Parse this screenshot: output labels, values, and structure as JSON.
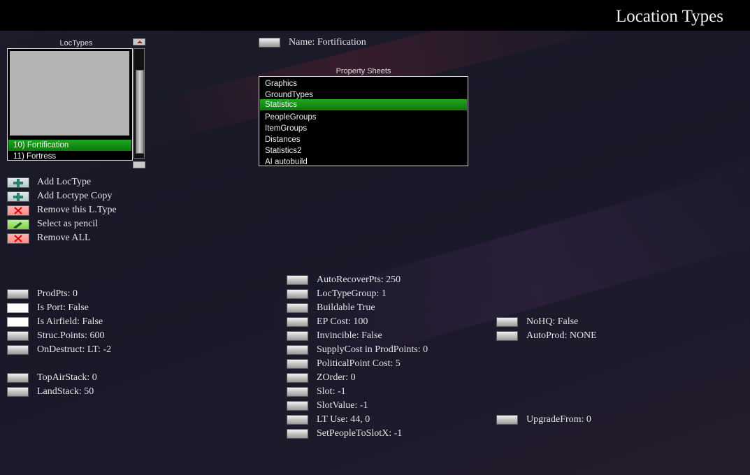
{
  "window": {
    "title": "Location Types"
  },
  "loctypes": {
    "title": "LocTypes",
    "items": [
      "10) Fortification",
      "11) Fortress"
    ],
    "selected_index": 0
  },
  "name_label": "Name: Fortification",
  "property_sheets": {
    "title": "Property Sheets",
    "items": [
      "Graphics",
      "GroundTypes",
      "Statistics",
      "PeopleGroups",
      "ItemGroups",
      "Distances",
      "Statistics2",
      "AI autobuild"
    ],
    "selected_index": 2
  },
  "actions": [
    {
      "label": "Add LocType",
      "icon": "plus-icon"
    },
    {
      "label": "Add Loctype Copy",
      "icon": "plus-icon"
    },
    {
      "label": "Remove this L.Type",
      "icon": "x-icon"
    },
    {
      "label": "Select as pencil",
      "icon": "pencil-icon"
    },
    {
      "label": "Remove ALL",
      "icon": "x-icon"
    }
  ],
  "left_props": [
    "ProdPts:  0",
    "Is Port: False",
    "Is Airfield: False",
    "Struc.Points:  600",
    "OnDestruct: LT: -2",
    "TopAirStack:  0",
    "LandStack:  50"
  ],
  "middle_props": [
    "AutoRecoverPts:  250",
    "LocTypeGroup:  1",
    "Buildable True",
    "EP Cost:  100",
    "Invincible: False",
    "SupplyCost in ProdPoints:  0",
    "PoliticalPoint Cost:  5",
    "ZOrder:  0",
    "Slot: -1",
    "SlotValue: -1",
    "LT Use:  44, 0",
    "SetPeopleToSlotX: -1"
  ],
  "right_props": [
    "NoHQ: False",
    "AutoProd: NONE",
    "UpgradeFrom:  0"
  ],
  "colors": {
    "selection": "#0f8a0f",
    "topbar": "#000000",
    "background": "#1a1a28"
  }
}
